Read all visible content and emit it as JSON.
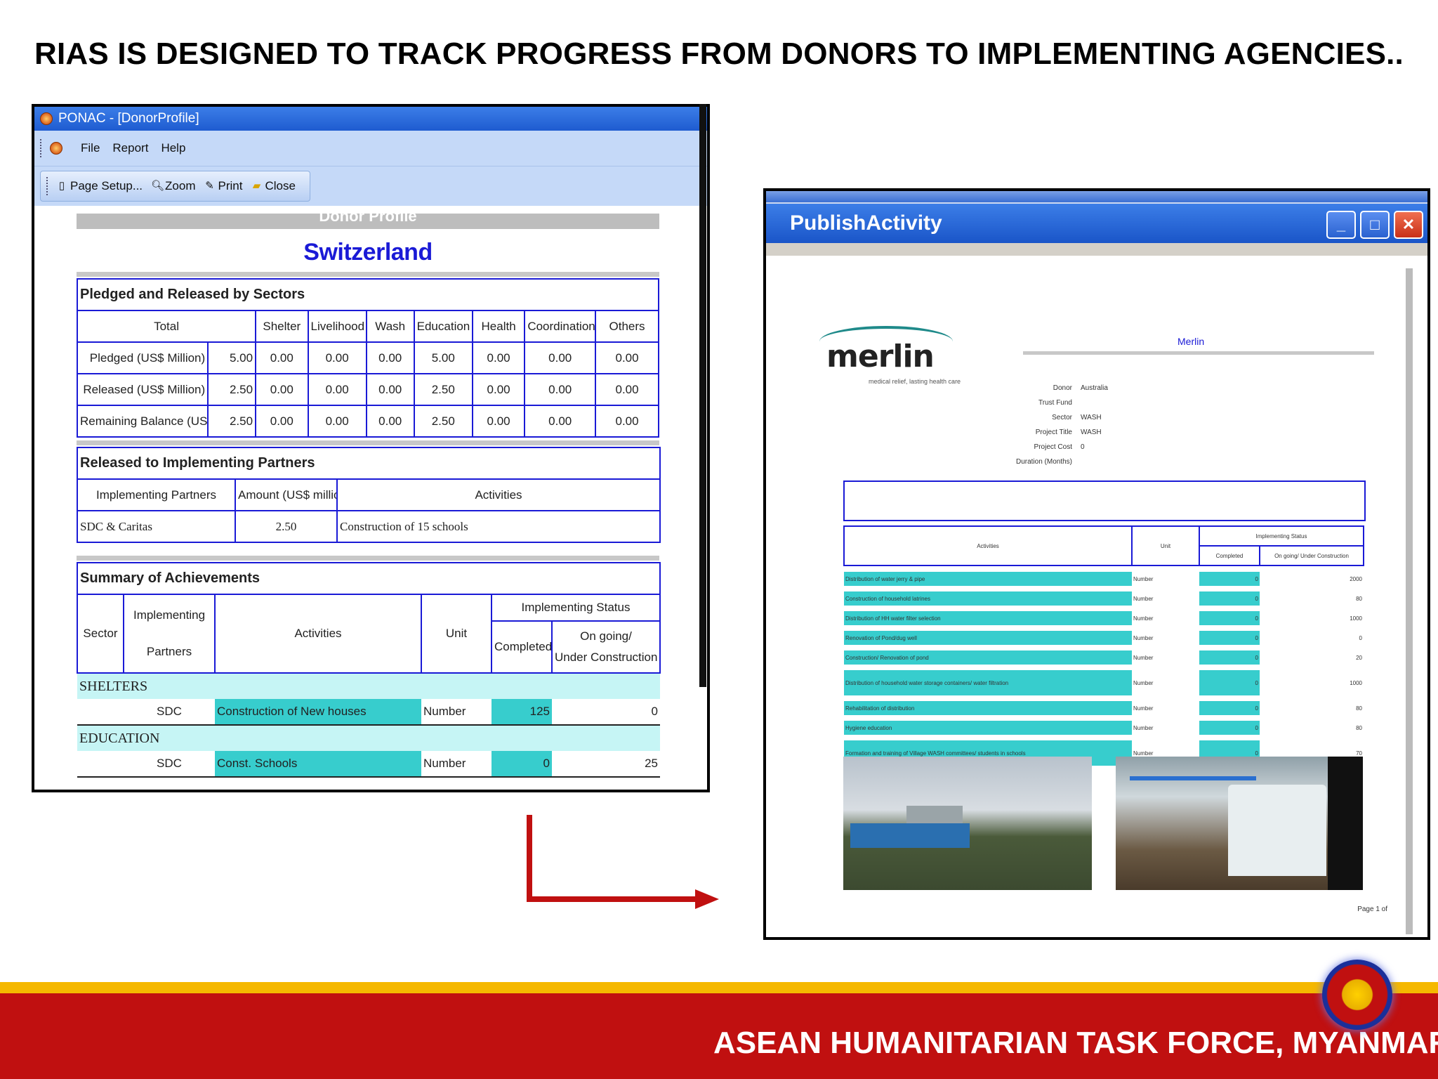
{
  "slide": {
    "title": "RIAS IS DESIGNED TO TRACK PROGRESS FROM DONORS TO IMPLEMENTING AGENCIES..",
    "footer": "ASEAN HUMANITARIAN TASK FORCE, MYANMAR"
  },
  "left_window": {
    "title": "PONAC - [DonorProfile]",
    "menu": [
      "File",
      "Report",
      "Help"
    ],
    "toolbar": [
      "Page Setup...",
      "Zoom",
      "Print",
      "Close"
    ],
    "report": {
      "heading": "Donor Profile",
      "donor": "Switzerland",
      "pledged_section": {
        "title": "Pledged and Released by Sectors",
        "columns": [
          "Total",
          "Shelter",
          "Livelihood",
          "Wash",
          "Education",
          "Health",
          "Coordination",
          "Others"
        ],
        "rows": [
          {
            "label": "Pledged (US$ Million)",
            "values": [
              "5.00",
              "0.00",
              "0.00",
              "0.00",
              "5.00",
              "0.00",
              "0.00",
              "0.00"
            ]
          },
          {
            "label": "Released (US$ Million)",
            "values": [
              "2.50",
              "0.00",
              "0.00",
              "0.00",
              "2.50",
              "0.00",
              "0.00",
              "0.00"
            ]
          },
          {
            "label": "Remaining Balance (US$ Million)",
            "values": [
              "2.50",
              "0.00",
              "0.00",
              "0.00",
              "2.50",
              "0.00",
              "0.00",
              "0.00"
            ]
          }
        ]
      },
      "released_section": {
        "title": "Released to Implementing Partners",
        "columns": [
          "Implementing Partners",
          "Amount (US$ million)",
          "Activities"
        ],
        "rows": [
          {
            "partner": "SDC & Caritas",
            "amount": "2.50",
            "activity": "Construction of 15 schools"
          }
        ]
      },
      "achievements_section": {
        "title": "Summary of Achievements",
        "col_sector": "Sector",
        "col_partners_1": "Implementing",
        "col_partners_2": "Partners",
        "col_activities": "Activities",
        "col_unit": "Unit",
        "col_status": "Implementing Status",
        "col_completed": "Completed",
        "col_ongoing_1": "On going/",
        "col_ongoing_2": "Under Construction",
        "groups": [
          {
            "sector": "SHELTERS",
            "partner": "SDC",
            "activity": "Construction of New houses",
            "unit": "Number",
            "completed": "125",
            "ongoing": "0"
          },
          {
            "sector": "EDUCATION",
            "partner": "SDC",
            "activity": "Const. Schools",
            "unit": "Number",
            "completed": "0",
            "ongoing": "25"
          }
        ]
      }
    }
  },
  "right_window": {
    "title": "PublishActivity",
    "controls": [
      "_",
      "□",
      "✕"
    ],
    "doc": {
      "logo": "merlin",
      "logo_tagline": "medical relief, lasting health care",
      "heading": "Merlin",
      "meta": [
        {
          "key": "Donor",
          "value": "Australia"
        },
        {
          "key": "Trust Fund",
          "value": ""
        },
        {
          "key": "Sector",
          "value": "WASH"
        },
        {
          "key": "Project Title",
          "value": "WASH"
        },
        {
          "key": "Project Cost",
          "value": "0"
        },
        {
          "key": "Duration (Months)",
          "value": ""
        }
      ],
      "table_head": {
        "activities": "Activities",
        "unit": "Unit",
        "status": "Implementing Status",
        "completed": "Completed",
        "ongoing": "On going/ Under Construction"
      },
      "rows": [
        {
          "activity": "Distribution of water jerry & pipe",
          "unit": "Number",
          "completed": "0",
          "ongoing": "2000"
        },
        {
          "activity": "Construction of household latrines",
          "unit": "Number",
          "completed": "0",
          "ongoing": "80"
        },
        {
          "activity": "Distribution of HH water filter selection",
          "unit": "Number",
          "completed": "0",
          "ongoing": "1000"
        },
        {
          "activity": "Renovation of Pond/dug well",
          "unit": "Number",
          "completed": "0",
          "ongoing": "0"
        },
        {
          "activity": "Construction/ Renovation of pond",
          "unit": "Number",
          "completed": "0",
          "ongoing": "20"
        },
        {
          "activity": "Distribution of household water storage containers/ water filtration",
          "unit": "Number",
          "completed": "0",
          "ongoing": "1000"
        },
        {
          "activity": "Rehabilitation of distribution",
          "unit": "Number",
          "completed": "0",
          "ongoing": "80"
        },
        {
          "activity": "Hygiene education",
          "unit": "Number",
          "completed": "0",
          "ongoing": "80"
        },
        {
          "activity": "Formation and training of Village WASH committees/ students in schools",
          "unit": "Number",
          "completed": "0",
          "ongoing": "70"
        }
      ],
      "page_label": "Page 1 of"
    }
  },
  "colors": {
    "accent_red": "#c01010",
    "gold": "#f5b800",
    "title_blue": "#1a1ad6",
    "teal": "#37cdcd"
  }
}
